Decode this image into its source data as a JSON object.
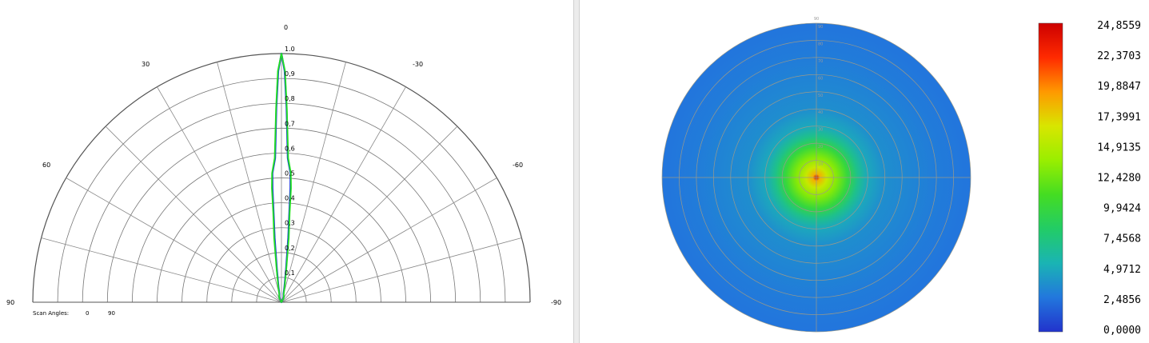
{
  "chart_data": [
    {
      "type": "polar_line",
      "angle_ticks": [
        "0",
        "30",
        "-30",
        "60",
        "-60",
        "90",
        "-90"
      ],
      "radial_ticks": [
        "1.0",
        "0,9",
        "0,8",
        "0,7",
        "0,6",
        "0,5",
        "0,4",
        "0,3",
        "0,2",
        "0,1"
      ],
      "rlim": [
        0,
        1
      ],
      "angle_range": [
        -90,
        90
      ],
      "legend": {
        "title": "Scan Angles:",
        "items": [
          "0",
          "90"
        ]
      },
      "series": [
        {
          "name": "0",
          "color": "#1a3fd6",
          "angles": [
            -26,
            -14,
            -11,
            -8,
            -6,
            -5,
            -4.5,
            -4,
            -2.5,
            -1.5,
            -0.8,
            0,
            0.8,
            1.5,
            2.5,
            4,
            4.5,
            5,
            6,
            8,
            11,
            14,
            26
          ],
          "r": [
            0.02,
            0.035,
            0.06,
            0.13,
            0.26,
            0.36,
            0.46,
            0.52,
            0.58,
            0.78,
            0.93,
            1.0,
            0.93,
            0.78,
            0.58,
            0.52,
            0.46,
            0.36,
            0.26,
            0.13,
            0.06,
            0.035,
            0.02
          ]
        },
        {
          "name": "90",
          "color": "#22e022",
          "angles": [
            -28,
            -15,
            -12,
            -8.5,
            -6.5,
            -5.3,
            -4.8,
            -4.2,
            -2.7,
            -1.6,
            -0.9,
            0,
            0.9,
            1.6,
            2.7,
            4.2,
            4.8,
            5.3,
            6.5,
            8.5,
            12,
            15,
            28
          ],
          "r": [
            0.02,
            0.035,
            0.06,
            0.13,
            0.26,
            0.36,
            0.46,
            0.52,
            0.58,
            0.78,
            0.93,
            1.0,
            0.93,
            0.78,
            0.58,
            0.52,
            0.46,
            0.36,
            0.26,
            0.13,
            0.06,
            0.035,
            0.02
          ]
        }
      ]
    },
    {
      "type": "heatmap",
      "projection": "polar",
      "radial_ticks": [
        "90",
        "90",
        "80",
        "70",
        "60",
        "50",
        "40",
        "30",
        "20",
        "10"
      ],
      "colorbar": {
        "labels": [
          "24,8559",
          "22,3703",
          "19,8847",
          "17,3991",
          "14,9135",
          "12,4280",
          "9,9424",
          "7,4568",
          "4,9712",
          "2,4856",
          "0,0000"
        ],
        "range": [
          0,
          24.8559
        ],
        "colors": [
          "#cc0000",
          "#ff2a00",
          "#ff9900",
          "#d8e600",
          "#99ee00",
          "#44dd22",
          "#22cc66",
          "#1ab4b4",
          "#2277dd",
          "#2233cc"
        ]
      },
      "profile": {
        "theta": [
          0,
          2,
          6,
          12,
          18,
          24,
          30,
          40,
          55,
          70,
          90
        ],
        "value": [
          24.8559,
          18.5,
          15.8,
          13.0,
          10.0,
          7.0,
          5.0,
          3.8,
          3.4,
          3.0,
          2.7
        ]
      }
    }
  ]
}
